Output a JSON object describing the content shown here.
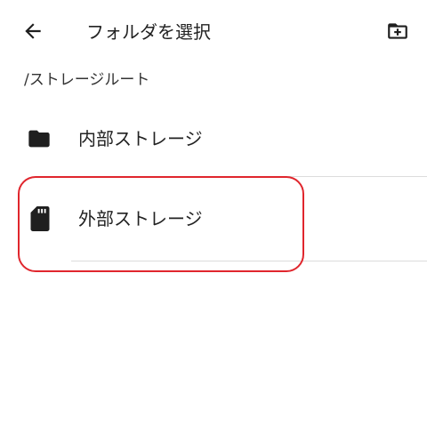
{
  "toolbar": {
    "back_icon": "arrow-left-icon",
    "title": "フォルダを選択",
    "new_folder_icon": "create-new-folder-icon"
  },
  "path": "/ストレージルート",
  "storage_list": [
    {
      "label": "内部ストレージ",
      "icon": "folder-icon"
    },
    {
      "label": "外部ストレージ",
      "icon": "sd-card-icon"
    }
  ],
  "colors": {
    "icon": "#1f1f1f",
    "divider": "#dcdcdc",
    "highlight": "#e0262d"
  }
}
